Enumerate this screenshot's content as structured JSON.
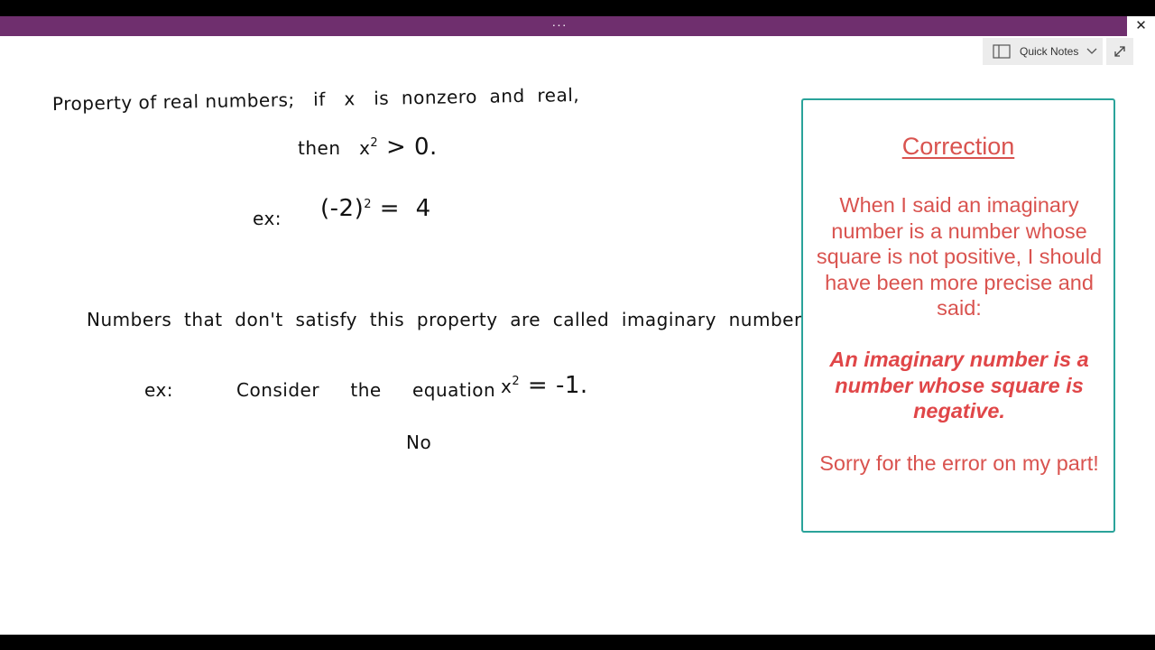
{
  "window": {
    "title_dots": "···",
    "close_glyph": "✕"
  },
  "toolbar": {
    "quick_notes_label": "Quick Notes",
    "notebook_icon": "notebook-icon",
    "chevron_icon": "chevron-down-icon",
    "expand_icon": "expand-icon"
  },
  "notes": {
    "line1": "Property of real numbers;   if   x   is  nonzero  and  real,",
    "line2_prefix": "then   x",
    "line2_sup": "2",
    "line2_suffix": " > 0.",
    "line3_ex": "ex:",
    "line3_base": "(-2)",
    "line3_sup": "2",
    "line3_eq": " =  4",
    "line4": "Numbers  that  don't  satisfy  this  property  are  called  imaginary  numbers.",
    "line5_ex": "ex:",
    "line5_text": "Consider     the     equation",
    "line5_x": "x",
    "line5_sup": "2",
    "line5_eq": " = -1.",
    "line6": "No"
  },
  "correction": {
    "title": "Correction",
    "body": "When I said an imaginary number is a number whose square is not positive, I should have been more precise and said:",
    "emphasis": "An imaginary number is a number whose square is negative.",
    "sorry": "Sorry for the error on my part!"
  },
  "colors": {
    "titlebar": "#6f2f6e",
    "card_border": "#2aa39a",
    "card_text": "#d9534f"
  }
}
